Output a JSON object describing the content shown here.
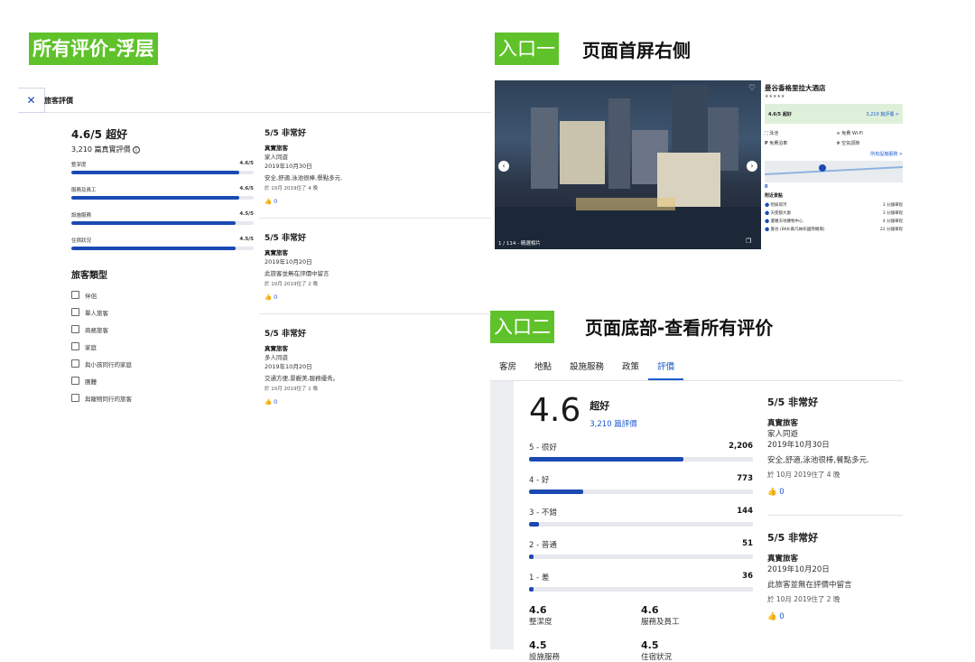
{
  "labels": {
    "overlay": "所有评价-浮层",
    "entry1": "入口一",
    "entry1_desc": "页面首屏右侧",
    "entry2": "入口二",
    "entry2_desc": "页面底部-查看所有评价"
  },
  "overlay": {
    "header": "旅客評價",
    "score_title": "4.6/5 超好",
    "review_count": "3,210 篇真實評價",
    "ratings": [
      {
        "label": "整潔度",
        "value": "4.6/5",
        "fill": 0.92
      },
      {
        "label": "服務及員工",
        "value": "4.6/5",
        "fill": 0.92
      },
      {
        "label": "設施服務",
        "value": "4.5/5",
        "fill": 0.9
      },
      {
        "label": "住宿狀況",
        "value": "4.5/5",
        "fill": 0.9
      }
    ],
    "traveler_type_title": "旅客類型",
    "traveler_types": [
      "伴侶",
      "單人旅客",
      "商務旅客",
      "家庭",
      "與小孩同行的家庭",
      "團體",
      "與寵物同行的旅客"
    ],
    "reviews": [
      {
        "rating": "5/5 非常好",
        "author": "真實旅客",
        "group": "家人同遊",
        "date": "2019年10月30日",
        "text": "安全,舒適,泳池很棒,餐點多元.",
        "stay": "於 10月 2019住了 4 晚",
        "likes": "0"
      },
      {
        "rating": "5/5 非常好",
        "author": "真實旅客",
        "group": "",
        "date": "2019年10月20日",
        "text": "此旅客並無在評價中留言",
        "stay": "於 10月 2019住了 2 晚",
        "likes": "0"
      },
      {
        "rating": "5/5 非常好",
        "author": "真實旅客",
        "group": "多人同遊",
        "date": "2019年10月20日",
        "text": "交通方便,景觀美,服務優秀。",
        "stay": "於 10月 2019住了 1 晚",
        "likes": "0"
      }
    ]
  },
  "hotel": {
    "name": "曼谷香格里拉大酒店",
    "stars": "★★★★★",
    "score": "4.6/5 超好",
    "score_link": "3,210 篇評價 >",
    "amenities": [
      "泳池",
      "免費 Wi-Fi",
      "免費泊車",
      "空氣調節"
    ],
    "all_amenities_link": "所有設施服務 >",
    "map_count": "0",
    "nearby_title": "附近景點",
    "nearby": [
      {
        "name": "昭披耶河",
        "time": "3 分鐘車程"
      },
      {
        "name": "天使都大廈",
        "time": "3 分鐘車程"
      },
      {
        "name": "暹羅天地購物中心",
        "time": "4 分鐘車程"
      },
      {
        "name": "曼谷 (BKK-蘇凡納布國際機場)",
        "time": "22 分鐘車程"
      }
    ],
    "photo_counter": "1 / 114 - 精選相片"
  },
  "bottom": {
    "tabs": [
      "客房",
      "地點",
      "設施服務",
      "政策",
      "評價"
    ],
    "big_score": "4.6",
    "score_word": "超好",
    "review_count": "3,210 篇評價",
    "distribution": [
      {
        "label": "5 - 很好",
        "count": "2,206",
        "fill": 0.69
      },
      {
        "label": "4 - 好",
        "count": "773",
        "fill": 0.24
      },
      {
        "label": "3 - 不錯",
        "count": "144",
        "fill": 0.045
      },
      {
        "label": "2 - 普通",
        "count": "51",
        "fill": 0.016
      },
      {
        "label": "1 - 差",
        "count": "36",
        "fill": 0.011
      }
    ],
    "subscores": [
      {
        "value": "4.6",
        "label": "整潔度"
      },
      {
        "value": "4.6",
        "label": "服務及員工"
      },
      {
        "value": "4.5",
        "label": "設施服務"
      },
      {
        "value": "4.5",
        "label": "住宿狀況"
      }
    ],
    "reviews": [
      {
        "rating": "5/5 非常好",
        "author": "真實旅客",
        "group": "家人同遊",
        "date": "2019年10月30日",
        "text": "安全,舒適,泳池很棒,餐點多元.",
        "stay": "於 10月 2019住了 4 晚",
        "likes": "0"
      },
      {
        "rating": "5/5 非常好",
        "author": "真實旅客",
        "group": "",
        "date": "2019年10月20日",
        "text": "此旅客並無在評價中留言",
        "stay": "於 10月 2019住了 2 晚",
        "likes": "0"
      }
    ]
  },
  "colors": {
    "tag_green": "#5fc22a",
    "brand_blue": "#1b4ab4",
    "link_blue": "#1b5ccf"
  }
}
